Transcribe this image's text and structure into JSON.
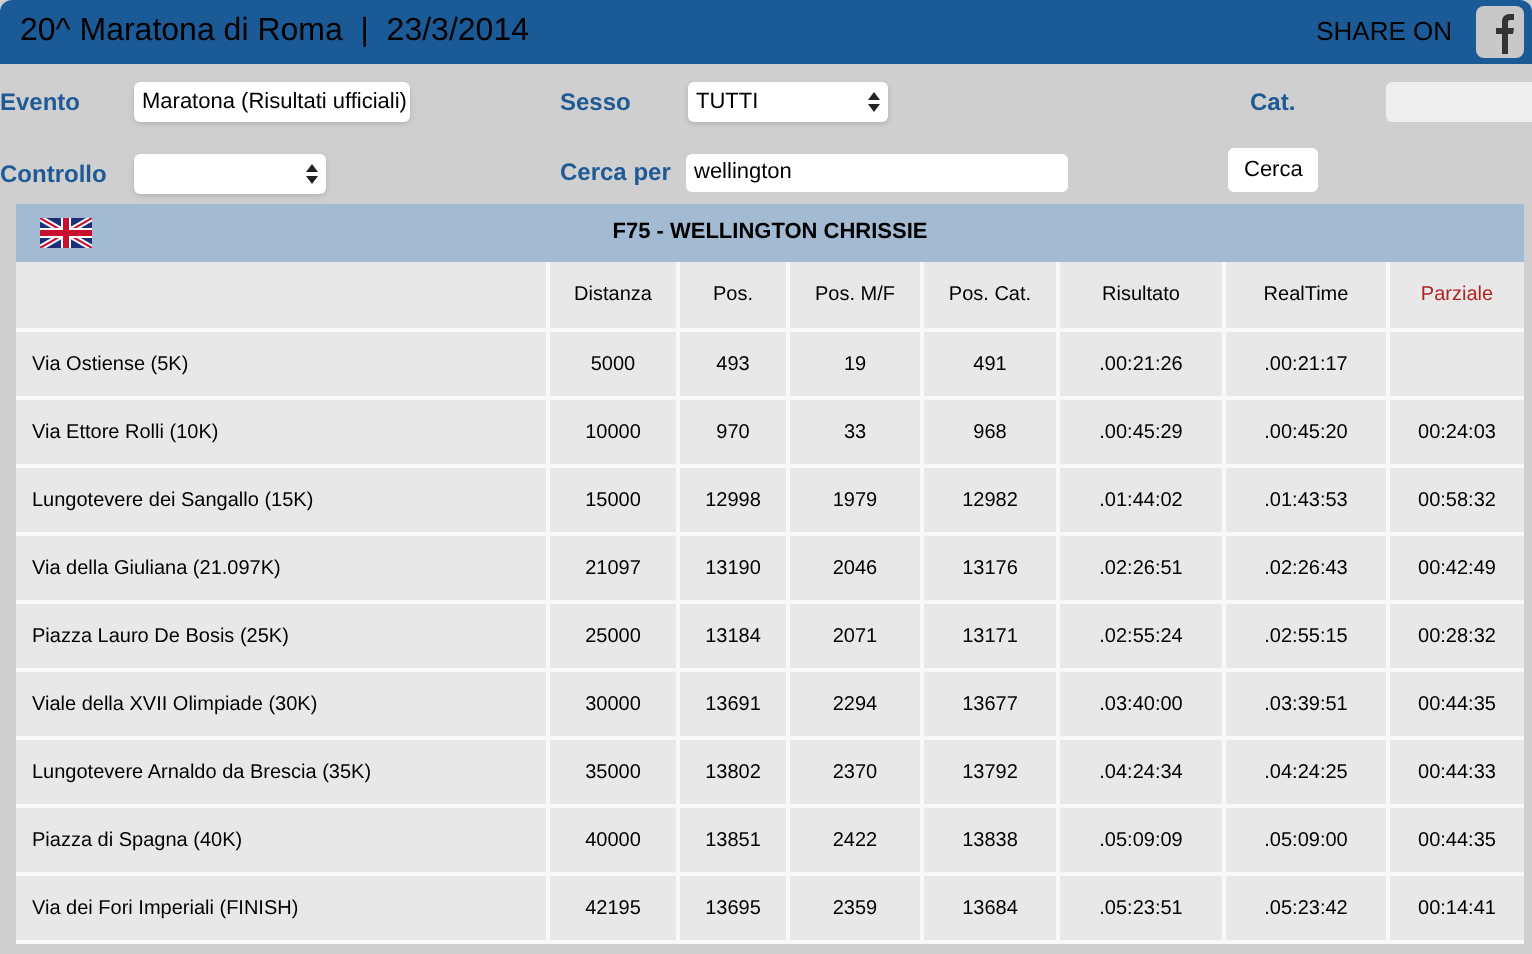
{
  "header": {
    "title": "20^ Maratona di Roma  |  23/3/2014",
    "share_label": "SHARE ON"
  },
  "filters": {
    "evento": {
      "label": "Evento",
      "value": "Maratona (Risultati ufficiali)"
    },
    "sesso": {
      "label": "Sesso",
      "value": "TUTTI"
    },
    "cat": {
      "label": "Cat."
    },
    "controllo": {
      "label": "Controllo"
    },
    "cerca_per": {
      "label": "Cerca per",
      "value": "wellington"
    },
    "search_button": "Cerca"
  },
  "results": {
    "athlete": "F75 - WELLINGTON CHRISSIE",
    "columns": [
      "",
      "Distanza",
      "Pos.",
      "Pos. M/F",
      "Pos. Cat.",
      "Risultato",
      "RealTime",
      "Parziale"
    ],
    "rows": [
      [
        "Via Ostiense (5K)",
        "5000",
        "493",
        "19",
        "491",
        ".00:21:26",
        ".00:21:17",
        ""
      ],
      [
        "Via Ettore Rolli (10K)",
        "10000",
        "970",
        "33",
        "968",
        ".00:45:29",
        ".00:45:20",
        "00:24:03"
      ],
      [
        "Lungotevere dei Sangallo (15K)",
        "15000",
        "12998",
        "1979",
        "12982",
        ".01:44:02",
        ".01:43:53",
        "00:58:32"
      ],
      [
        "Via della Giuliana (21.097K)",
        "21097",
        "13190",
        "2046",
        "13176",
        ".02:26:51",
        ".02:26:43",
        "00:42:49"
      ],
      [
        "Piazza Lauro De Bosis (25K)",
        "25000",
        "13184",
        "2071",
        "13171",
        ".02:55:24",
        ".02:55:15",
        "00:28:32"
      ],
      [
        "Viale della XVII Olimpiade (30K)",
        "30000",
        "13691",
        "2294",
        "13677",
        ".03:40:00",
        ".03:39:51",
        "00:44:35"
      ],
      [
        "Lungotevere Arnaldo da Brescia (35K)",
        "35000",
        "13802",
        "2370",
        "13792",
        ".04:24:34",
        ".04:24:25",
        "00:44:33"
      ],
      [
        "Piazza di Spagna (40K)",
        "40000",
        "13851",
        "2422",
        "13838",
        ".05:09:09",
        ".05:09:00",
        "00:44:35"
      ],
      [
        "Via dei Fori Imperiali (FINISH)",
        "42195",
        "13695",
        "2359",
        "13684",
        ".05:23:51",
        ".05:23:42",
        "00:14:41"
      ]
    ]
  }
}
